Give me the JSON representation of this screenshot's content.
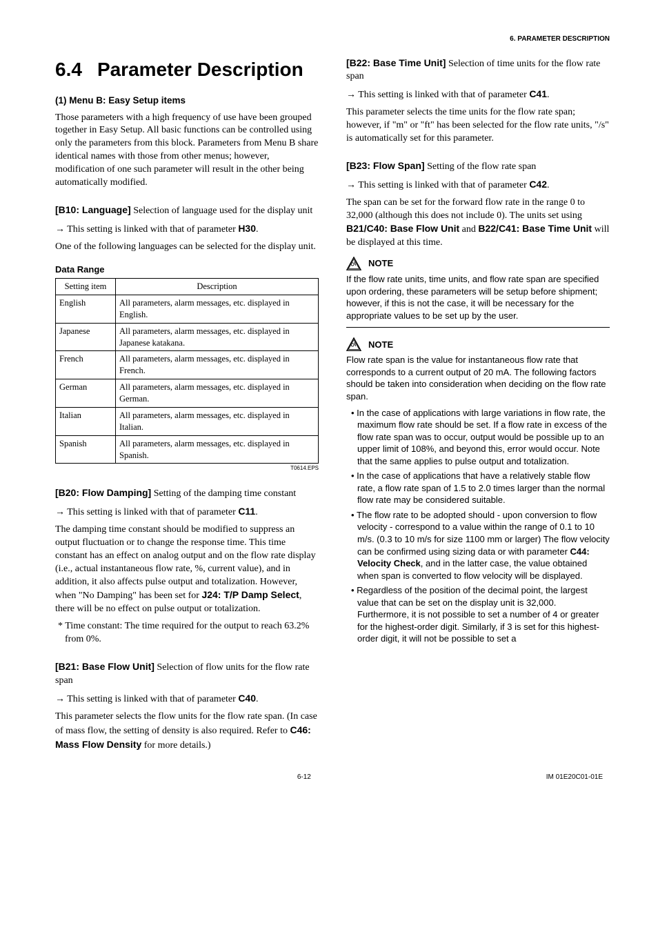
{
  "header": {
    "breadcrumb": "6.  PARAMETER DESCRIPTION"
  },
  "title": {
    "num": "6.4",
    "text": "Parameter Description"
  },
  "left": {
    "s1": {
      "head": "(1) Menu B: Easy Setup items",
      "p": "Those parameters with a high frequency of use have been grouped together in Easy Setup. All basic functions can be controlled using only the parameters from this block. Parameters from Menu B share identical names with those from other menus; however, modification of one such parameter will result in the other being automatically modified."
    },
    "b10": {
      "label": "[B10: Language]",
      "rest": " Selection of language used for the display unit",
      "arrow": "→ This setting is linked with that of parameter ",
      "ref": "H30",
      "after": ".",
      "p2": "One of the following languages can be selected for the display unit."
    },
    "dataRange": "Data Range",
    "table": {
      "h1": "Setting item",
      "h2": "Description",
      "rows": [
        {
          "k": "English",
          "v": "All parameters, alarm messages, etc. displayed in English."
        },
        {
          "k": "Japanese",
          "v": "All parameters, alarm messages, etc. displayed in Japanese katakana."
        },
        {
          "k": "French",
          "v": "All parameters, alarm messages, etc. displayed in French."
        },
        {
          "k": "German",
          "v": "All parameters, alarm messages, etc. displayed in German."
        },
        {
          "k": "Italian",
          "v": "All parameters, alarm messages, etc. displayed in Italian."
        },
        {
          "k": "Spanish",
          "v": "All parameters, alarm messages, etc. displayed in Spanish."
        }
      ],
      "foot": "T0614.EPS"
    },
    "b20": {
      "label": "[B20: Flow Damping]",
      "rest": " Setting of the damping time constant",
      "arrow": "→ This setting is linked with that of parameter ",
      "ref": "C11",
      "after": ".",
      "p2a": "The damping time constant should be modified to suppress an output fluctuation or to change the response time. This time constant has an effect on analog output and on the flow rate display (i.e., actual instantaneous flow rate, %, current value), and in addition, it also affects pulse output and totalization. However, when \"No Damping\" has been set for ",
      "ref2": "J24: T/P Damp Select",
      "p2b": ", there will be no effect on pulse output or totalization.",
      "foot": "* Time constant: The time required for the output to reach 63.2% from 0%."
    },
    "b21": {
      "label": "[B21: Base Flow Unit]",
      "rest": " Selection of flow units for the flow rate span",
      "arrow": "→ This setting is linked with that of parameter ",
      "ref": "C40",
      "after": ".",
      "p2a": "This parameter selects the flow units for the flow rate span. (In case of mass flow, the setting of density is also required.  Refer to ",
      "ref2": "C46: Mass Flow Density",
      "p2b": " for more details.)"
    }
  },
  "right": {
    "b22": {
      "label": "[B22: Base Time Unit]",
      "rest": " Selection of time units for the flow rate span",
      "arrow": "→ This setting is linked with that of parameter ",
      "ref": "C41",
      "after": ".",
      "p2": "This parameter selects the time units for the flow rate span; however, if \"m\" or \"ft\" has been selected for the flow rate units, \"/s\" is automatically set for this parameter."
    },
    "b23": {
      "label": "[B23: Flow Span]",
      "rest": " Setting of the flow rate span",
      "arrow": "→ This setting is linked with that of parameter ",
      "ref": "C42",
      "after": ".",
      "p2a": "The span can be set for the forward flow rate in the range 0 to 32,000 (although this does not include 0). The units set using ",
      "ref2": "B21/C40: Base Flow Unit",
      "mid": " and ",
      "ref3": "B22/C41: Base Time Unit",
      "p2b": " will be displayed at this time."
    },
    "noteLabel": "NOTE",
    "note1": {
      "body": "If the flow rate units, time units, and flow rate span are specified upon ordering, these parameters will be setup before shipment; however, if this is not the case, it will be necessary for the appropriate values to be set up by the user."
    },
    "note2": {
      "intro": "Flow rate span is the value for instantaneous flow rate that corresponds to a current output of 20 mA. The following factors should be taken into consideration when deciding on the flow rate span.",
      "b1": "In the case of applications with large variations in flow rate, the maximum flow rate should be set. If a flow rate in excess of the flow rate span was to occur, output would be possible up to an upper limit of 108%, and beyond this, error would occur. Note that the same applies to pulse output and totalization.",
      "b2": "In the case of applications that have a relatively stable flow rate, a flow rate span of 1.5 to 2.0 times larger than the normal flow rate may be considered suitable.",
      "b3a": "The flow rate to be adopted should - upon conversion to flow velocity - correspond to a value within the range of 0.1 to 10 m/s. (0.3 to 10 m/s for size 1100 mm or larger) The flow velocity can be confirmed using sizing data or with parameter ",
      "b3ref": "C44: Velocity Check",
      "b3b": ", and in the latter case, the value obtained when span is converted to flow velocity will be displayed.",
      "b4": "Regardless of the position of the decimal point, the largest value that can be set on the display unit is 32,000. Furthermore, it is not possible to set a number of 4 or greater for the highest-order digit. Similarly, if 3 is set for this highest-order digit, it will not be possible to set a"
    }
  },
  "footer": {
    "page": "6-12",
    "doc": "IM 01E20C01-01E"
  }
}
